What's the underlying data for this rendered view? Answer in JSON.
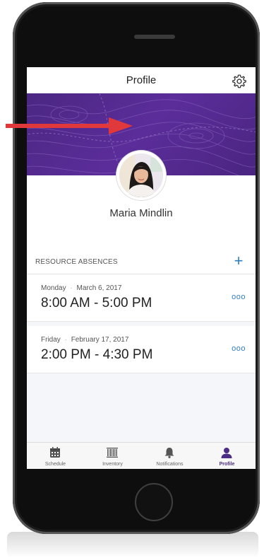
{
  "header": {
    "title": "Profile",
    "settings_icon": "gear-icon"
  },
  "profile": {
    "name": "Maria Mindlin"
  },
  "absences": {
    "section_title": "RESOURCE ABSENCES",
    "add_icon": "plus-icon",
    "add_label": "+",
    "items": [
      {
        "day": "Monday",
        "separator": "·",
        "date": "March 6, 2017",
        "time": "8:00 AM - 5:00 PM",
        "more": "ooo"
      },
      {
        "day": "Friday",
        "separator": "·",
        "date": "February 17, 2017",
        "time": "2:00 PM - 4:30 PM",
        "more": "ooo"
      }
    ]
  },
  "tabs": [
    {
      "label": "Schedule",
      "icon": "calendar-icon",
      "active": false
    },
    {
      "label": "Inventory",
      "icon": "barcode-icon",
      "active": false
    },
    {
      "label": "Notifications",
      "icon": "bell-icon",
      "active": false
    },
    {
      "label": "Profile",
      "icon": "user-icon",
      "active": true
    }
  ],
  "colors": {
    "accent": "#2e7ec2",
    "banner": "#4b2782",
    "arrow": "#e0383b",
    "active_tab": "#4b2d86"
  }
}
